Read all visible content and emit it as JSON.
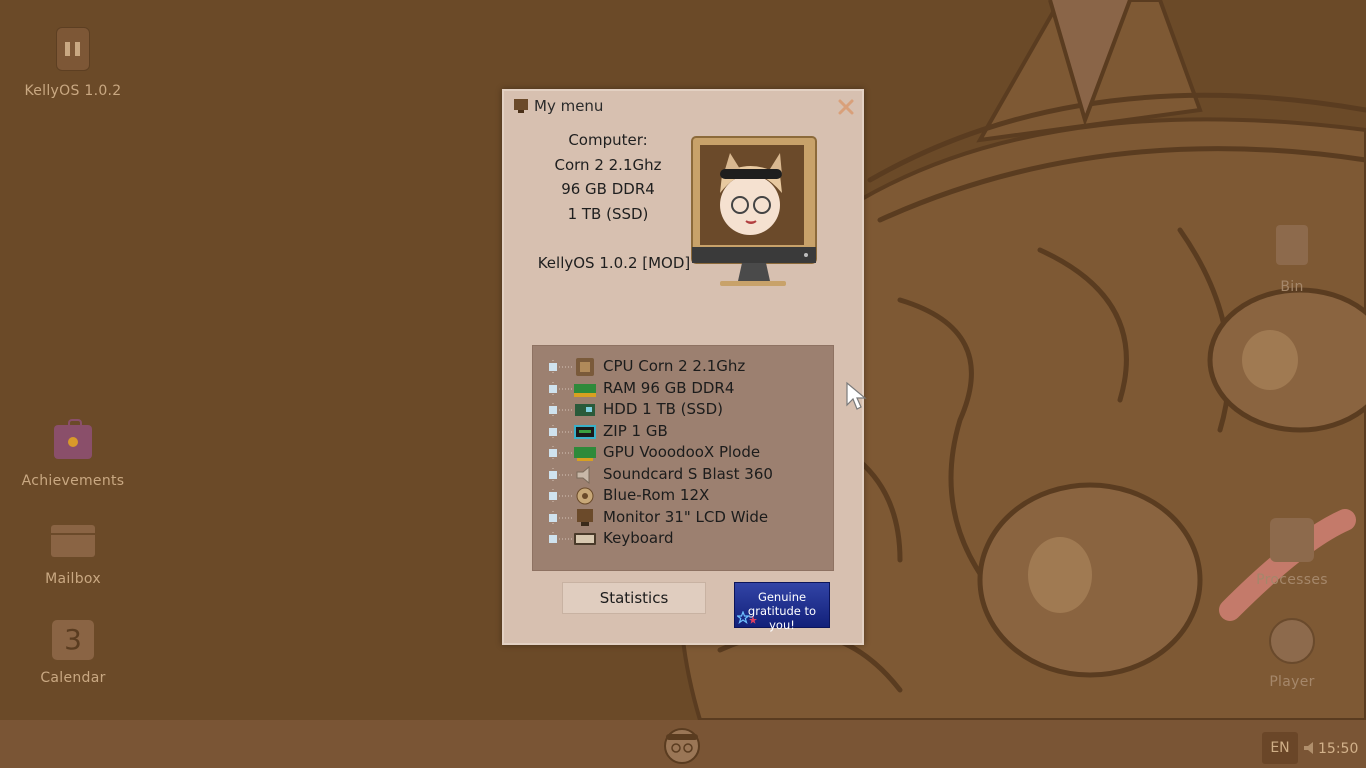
{
  "desktop": {
    "icons": [
      {
        "label": "KellyOS 1.0.2",
        "icon": "kellyos-icon"
      },
      {
        "label": "Achievements",
        "icon": "achievements-icon"
      },
      {
        "label": "Mailbox",
        "icon": "mailbox-icon"
      },
      {
        "label": "Calendar",
        "icon": "calendar-icon",
        "day": "3"
      },
      {
        "label": "Bin",
        "icon": "bin-icon"
      },
      {
        "label": "Processes",
        "icon": "processes-icon"
      },
      {
        "label": "Player",
        "icon": "player-icon"
      }
    ]
  },
  "window": {
    "title": "My menu",
    "computer_heading": "Computer:",
    "specs": [
      "Corn 2 2.1Ghz",
      "96 GB DDR4",
      "1 TB (SSD)"
    ],
    "os_version": "KellyOS 1.0.2 [MOD]",
    "components": [
      {
        "label": "CPU Corn 2 2.1Ghz",
        "icon": "cpu-icon"
      },
      {
        "label": "RAM 96 GB DDR4",
        "icon": "ram-icon"
      },
      {
        "label": "HDD 1 TB (SSD)",
        "icon": "hdd-icon"
      },
      {
        "label": "ZIP 1 GB",
        "icon": "zip-icon"
      },
      {
        "label": "GPU VooodooX Plode",
        "icon": "gpu-icon"
      },
      {
        "label": "Soundcard S Blast 360",
        "icon": "soundcard-icon"
      },
      {
        "label": "Blue-Rom 12X",
        "icon": "disc-icon"
      },
      {
        "label": "Monitor 31\" LCD Wide",
        "icon": "monitor-icon"
      },
      {
        "label": "Keyboard",
        "icon": "keyboard-icon"
      }
    ],
    "statistics_label": "Statistics",
    "gratitude_label": "Genuine gratitude to you!"
  },
  "taskbar": {
    "language": "EN",
    "clock": "15:50"
  },
  "colors": {
    "desktop_bg": "#6b4a28",
    "taskbar_bg": "#7a5535",
    "window_bg": "#d7c0b0",
    "panel_bg": "#9c8070",
    "gratitude_bg": "#1e2d8f"
  }
}
